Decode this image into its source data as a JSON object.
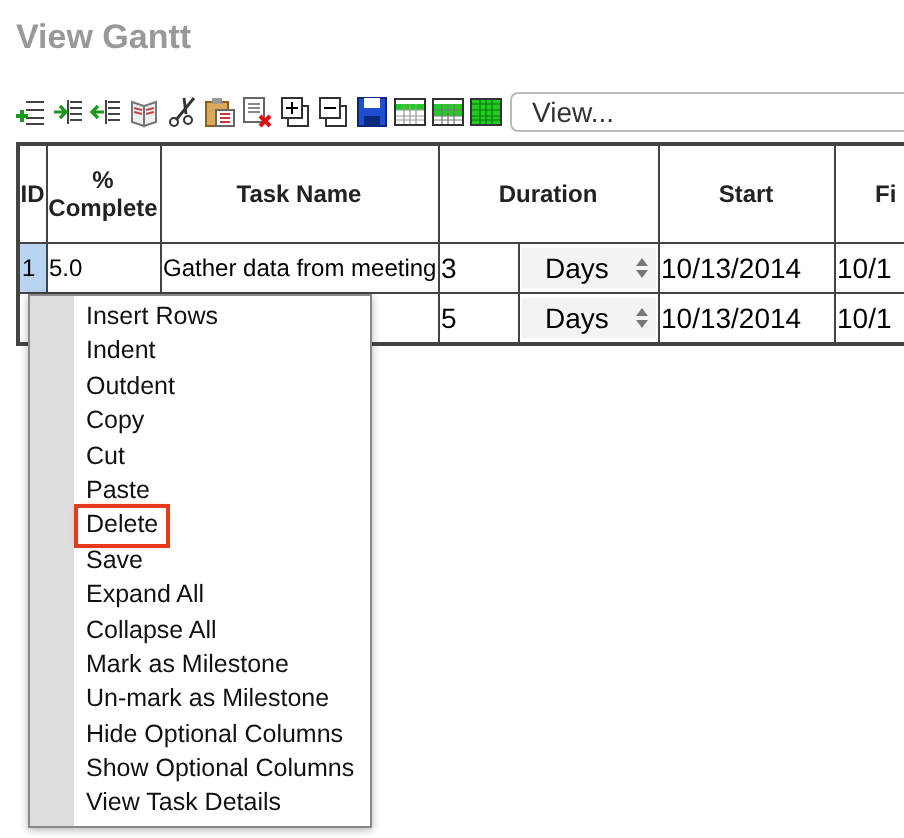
{
  "title": "View Gantt",
  "view_select": {
    "value": "View..."
  },
  "table": {
    "columns": [
      "ID",
      "% Complete",
      "Task Name",
      "Duration",
      "Start",
      "Fi"
    ],
    "rows": [
      {
        "id": "1",
        "id_selected": true,
        "complete": "5.0",
        "task": "Gather data from meeting",
        "duration": "3",
        "unit": "Days",
        "start": "10/13/2014",
        "finish": "10/1"
      },
      {
        "id": "",
        "id_selected": false,
        "complete": "",
        "task": "",
        "duration": "5",
        "unit": "Days",
        "start": "10/13/2014",
        "finish": "10/1"
      }
    ]
  },
  "context_menu": {
    "items": [
      {
        "label": "Insert Rows",
        "selected": false
      },
      {
        "label": "Indent",
        "selected": false
      },
      {
        "label": "Outdent",
        "selected": false
      },
      {
        "label": "Copy",
        "selected": false
      },
      {
        "label": "Cut",
        "selected": false
      },
      {
        "label": "Paste",
        "selected": false
      },
      {
        "label": "Delete",
        "selected": true
      },
      {
        "label": "Save",
        "selected": false
      },
      {
        "label": "Expand All",
        "selected": false
      },
      {
        "label": "Collapse All",
        "selected": false
      },
      {
        "label": "Mark as Milestone",
        "selected": false
      },
      {
        "label": "Un-mark as Milestone",
        "selected": false
      },
      {
        "label": "Hide Optional Columns",
        "selected": false
      },
      {
        "label": "Show Optional Columns",
        "selected": false
      },
      {
        "label": "View Task Details",
        "selected": false
      }
    ]
  }
}
